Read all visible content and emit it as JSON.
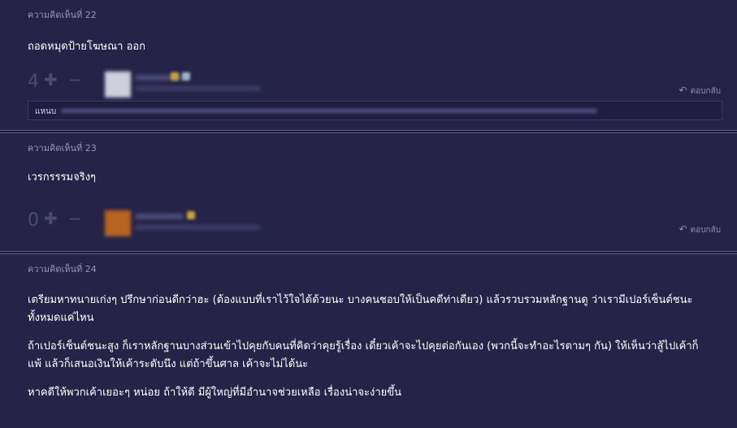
{
  "comments": [
    {
      "label": "ความคิดเห็นที่ 22",
      "body": [
        "ถอดหมุดป้ายโฆษณา ออก"
      ],
      "votes": "4",
      "reply_label": "ตอบกลับ",
      "reply_prefix": "แหนบ"
    },
    {
      "label": "ความคิดเห็นที่ 23",
      "body": [
        "เวรกรรรมจริงๆ"
      ],
      "votes": "0",
      "reply_label": "ตอบกลับ"
    },
    {
      "label": "ความคิดเห็นที่ 24",
      "body": [
        "เตรียมหาทนายเก่งๆ ปรึกษาก่อนดีกว่าฮะ (ต้องแบบที่เราไว้ใจได้ด้วยนะ บางคนชอบให้เป็นคดีท่าเดียว) แล้วรวบรวมหลักฐานดู ว่าเรามีเปอร์เซ็นต์ชนะทั้งหมดแค่ไหน",
        "ถ้าเปอร์เซ็นต์ชนะสูง ก็เราหลักฐานบางส่วนเข้าไปคุยกับคนที่คิดว่าคุยรู้เรื่อง เดี๋ยวเค้าจะไปคุยต่อกันเอง (พวกนี้จะทำอะไรตามๆ กัน) ให้เห็นว่าสู้ไปเค้าก็แพ้ แล้วก็เสนอเงินให้เค้าระดับนึง แต่ถ้าขึ้นศาล เค้าจะไม่ได้นะ",
        "หาคดีให้พวกเค้าเยอะๆ หน่อย ถ้าให้ดี มีผู้ใหญ่ที่มีอำนาจช่วยเหลือ เรื่องน่าจะง่ายขึ้น"
      ]
    }
  ],
  "colors": {
    "background": "#252448",
    "divider": "#5d5c86",
    "label": "#9695b3",
    "text": "#ffffff"
  },
  "icons": {
    "upvote": "plus-icon",
    "downvote": "minus-icon",
    "reply": "reply-arrow-icon"
  }
}
